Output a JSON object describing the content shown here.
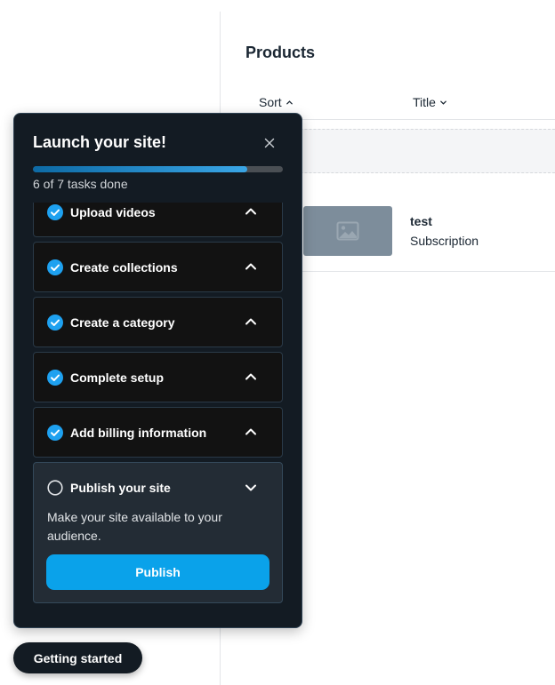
{
  "products": {
    "title": "Products",
    "columns": [
      {
        "label": "Sort",
        "sort_icon": "chevron-up-icon"
      },
      {
        "label": "Title",
        "sort_icon": "chevron-down-icon"
      }
    ],
    "rows": [
      {
        "name": "test",
        "type": "Subscription",
        "thumbnail_icon": "image-placeholder-icon"
      }
    ]
  },
  "launch_panel": {
    "title": "Launch your site!",
    "close_icon": "close-icon",
    "progress": {
      "done": 6,
      "total": 7,
      "fraction": 0.857,
      "label": "6 of 7 tasks done"
    },
    "colors": {
      "accent": "#0aa2ea",
      "panel_bg": "#131b23"
    },
    "tasks": [
      {
        "label": "Upload videos",
        "done": true
      },
      {
        "label": "Create collections",
        "done": true
      },
      {
        "label": "Create a category",
        "done": true
      },
      {
        "label": "Complete setup",
        "done": true
      },
      {
        "label": "Add billing information",
        "done": true
      }
    ],
    "open_task": {
      "label": "Publish your site",
      "done": false,
      "description": "Make your site available to your audience.",
      "button_label": "Publish"
    }
  },
  "getting_started_button": "Getting started"
}
